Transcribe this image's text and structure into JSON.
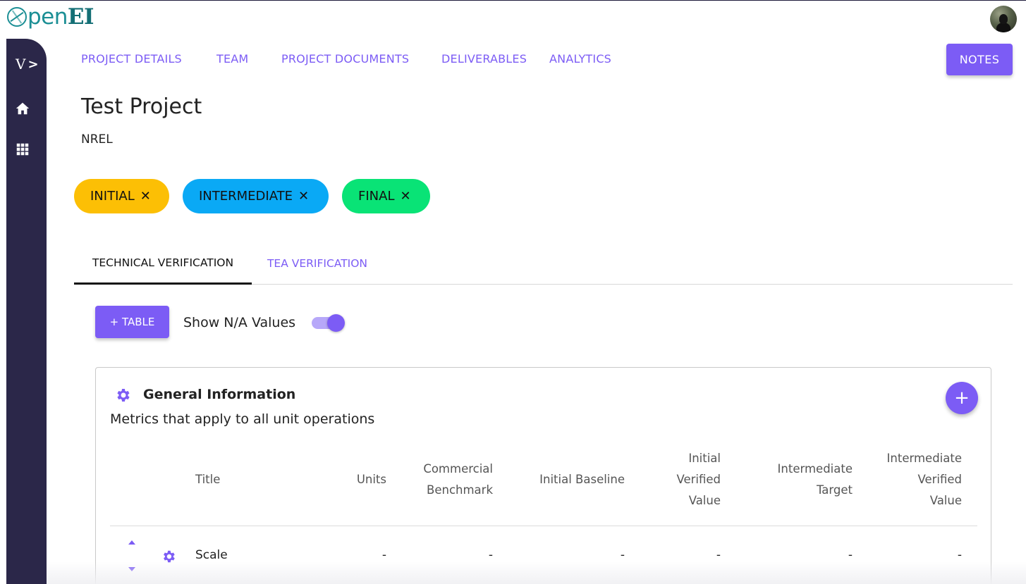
{
  "brand": {
    "logo_o": "O",
    "logo_pen": "pen",
    "logo_ei": "EI"
  },
  "sidebar": {
    "toggle_label": "V",
    "toggle_chevron": ">"
  },
  "nav": {
    "items": [
      "PROJECT DETAILS",
      "TEAM",
      "PROJECT DOCUMENTS",
      "DELIVERABLES",
      "ANALYTICS"
    ],
    "notes_label": "NOTES"
  },
  "project": {
    "title": "Test Project",
    "organization": "NREL"
  },
  "chips": [
    {
      "label": "INITIAL",
      "close": "✕",
      "color": "#fcbf05"
    },
    {
      "label": "INTERMEDIATE",
      "close": "✕",
      "color": "#0aa9f5"
    },
    {
      "label": "FINAL",
      "close": "✕",
      "color": "#09e376"
    }
  ],
  "tabs": {
    "active": "TECHNICAL VERIFICATION",
    "other": "TEA VERIFICATION"
  },
  "toolbar": {
    "add_table_label": "+ TABLE",
    "show_na_label": "Show N/A Values",
    "show_na_enabled": true
  },
  "card": {
    "title": "General Information",
    "subtitle": "Metrics that apply to all unit operations",
    "add_label": "+",
    "columns": {
      "title": "Title",
      "units": "Units",
      "commercial_benchmark": [
        "Commercial",
        "Benchmark"
      ],
      "initial_baseline": "Initial Baseline",
      "initial_verified": [
        "Initial",
        "Verified",
        "Value"
      ],
      "intermediate_target": [
        "Intermediate",
        "Target"
      ],
      "intermediate_verified": [
        "Intermediate",
        "Verified",
        "Value"
      ]
    },
    "rows": [
      {
        "title": "Scale",
        "units": "-",
        "commercial_benchmark": "-",
        "initial_baseline": "-",
        "initial_verified": "-",
        "intermediate_target": "-",
        "intermediate_verified": "-"
      }
    ]
  },
  "colors": {
    "accent": "#7c5cf5",
    "sidebar": "#2b2749",
    "brand": "#1c8f95"
  },
  "icons": [
    "user-avatar",
    "home-icon",
    "apps-grid-icon",
    "gear-icon",
    "caret-up-icon",
    "caret-down-icon",
    "plus-icon",
    "close-icon"
  ]
}
